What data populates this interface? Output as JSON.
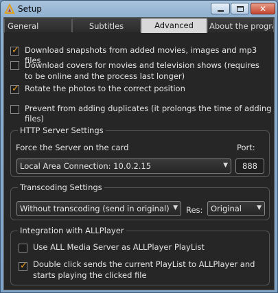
{
  "window": {
    "title": "Setup"
  },
  "tabs": [
    {
      "label": "General"
    },
    {
      "label": "Subtitles"
    },
    {
      "label": "Advanced"
    },
    {
      "label": "About the program"
    }
  ],
  "options": [
    {
      "label": "Download snapshots from added movies, images and mp3 files",
      "checked": true
    },
    {
      "label": "Download covers for movies and television shows (requires to be online and the process last longer)",
      "checked": false
    },
    {
      "label": "Rotate the photos to the correct position",
      "checked": true
    },
    {
      "label": "Prevent from adding duplicates (it prolongs the time of adding files)",
      "checked": false
    }
  ],
  "http": {
    "title": "HTTP Server Settings",
    "force_label": "Force the Server on the card",
    "port_label": "Port:",
    "connection": "Local Area Connection: 10.0.2.15",
    "port": "888"
  },
  "transcoding": {
    "title": "Transcoding Settings",
    "mode": "Without transcoding (send in original)",
    "res_label": "Res:",
    "res": "Original"
  },
  "integration": {
    "title": "Integration with ALLPlayer",
    "opt1": {
      "label": "Use ALL Media Server as ALLPlayer PlayList",
      "checked": false
    },
    "opt2": {
      "label": "Double click sends the current PlayList to ALLPlayer and starts playing the clicked file",
      "checked": true
    }
  },
  "colors": {
    "check_mark": "#f0a020",
    "background": "#262626",
    "close_button": "#c4462f"
  }
}
